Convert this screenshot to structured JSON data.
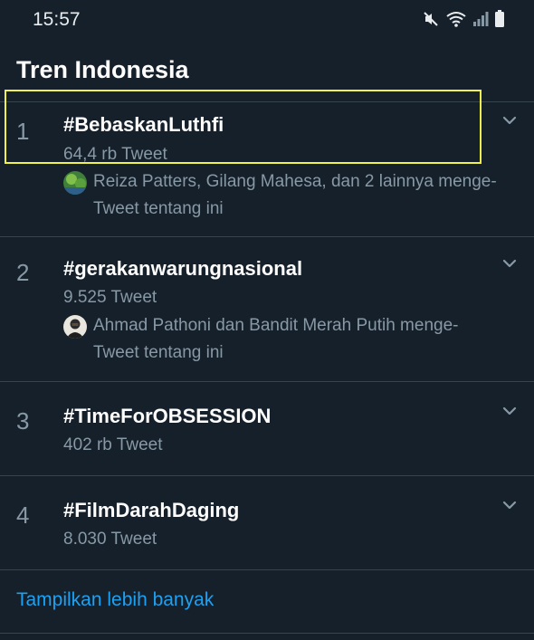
{
  "status_bar": {
    "time": "15:57",
    "icons": [
      "mute-icon",
      "wifi-icon",
      "signal-icon",
      "battery-icon"
    ]
  },
  "section": {
    "title": "Tren Indonesia"
  },
  "trends": [
    {
      "rank": "1",
      "name": "#BebaskanLuthfi",
      "count": "64,4 rb Tweet",
      "context": "Reiza Patters, Gilang Mahesa, dan 2 lainnya menge-Tweet tentang ini",
      "avatar": "green-landscape"
    },
    {
      "rank": "2",
      "name": "#gerakanwarungnasional",
      "count": "9.525 Tweet",
      "context": "Ahmad Pathoni dan Bandit Merah Putih menge-Tweet tentang ini",
      "avatar": "man-portrait"
    },
    {
      "rank": "3",
      "name": "#TimeForOBSESSION",
      "count": "402 rb Tweet"
    },
    {
      "rank": "4",
      "name": "#FilmDarahDaging",
      "count": "8.030 Tweet"
    }
  ],
  "show_more": "Tampilkan lebih banyak",
  "colors": {
    "background": "#15202b",
    "divider": "#38444d",
    "secondary_text": "#8899a6",
    "link": "#1da1f2",
    "highlight": "#f1f14b"
  }
}
